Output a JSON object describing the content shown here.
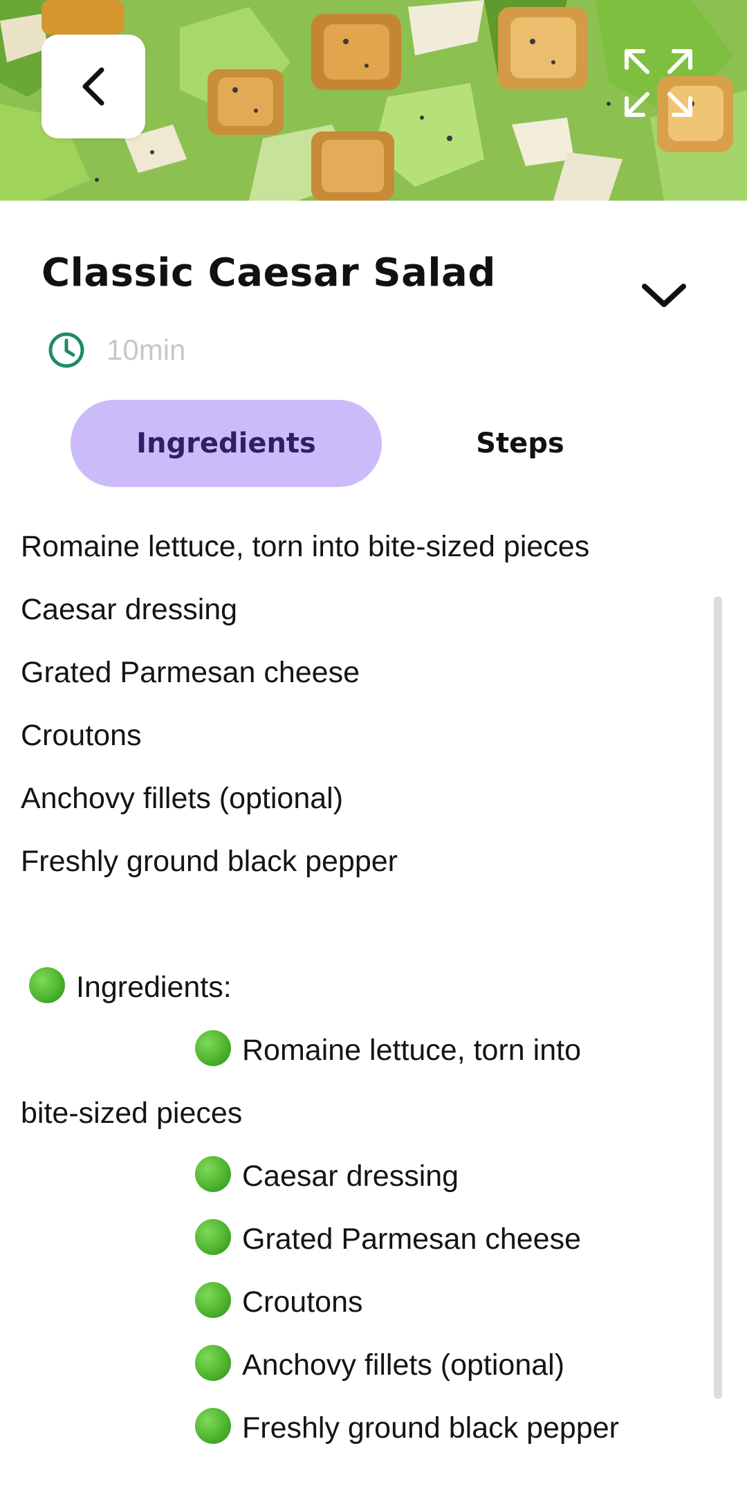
{
  "header": {
    "back_icon": "chevron-left-icon",
    "expand_icon": "expand-icon"
  },
  "recipe": {
    "title": "Classic Caesar Salad",
    "time": "10min",
    "collapse_icon": "chevron-down-icon",
    "time_icon": "clock-icon"
  },
  "tabs": {
    "ingredients": "Ingredients",
    "steps": "Steps",
    "active": "Ingredients",
    "active_color": "#cbbcf9"
  },
  "content": {
    "plain_items": [
      "Romaine lettuce, torn into bite-sized pieces",
      "Caesar dressing",
      "Grated Parmesan cheese",
      "Croutons",
      "Anchovy fillets (optional)",
      "Freshly ground black pepper"
    ],
    "section_heading": "Ingredients:",
    "bullet_items": [
      "Romaine lettuce, torn into",
      "bite-sized pieces",
      "Caesar dressing",
      "Grated Parmesan cheese",
      "Croutons",
      "Anchovy fillets (optional)",
      "Freshly ground black pepper"
    ]
  }
}
